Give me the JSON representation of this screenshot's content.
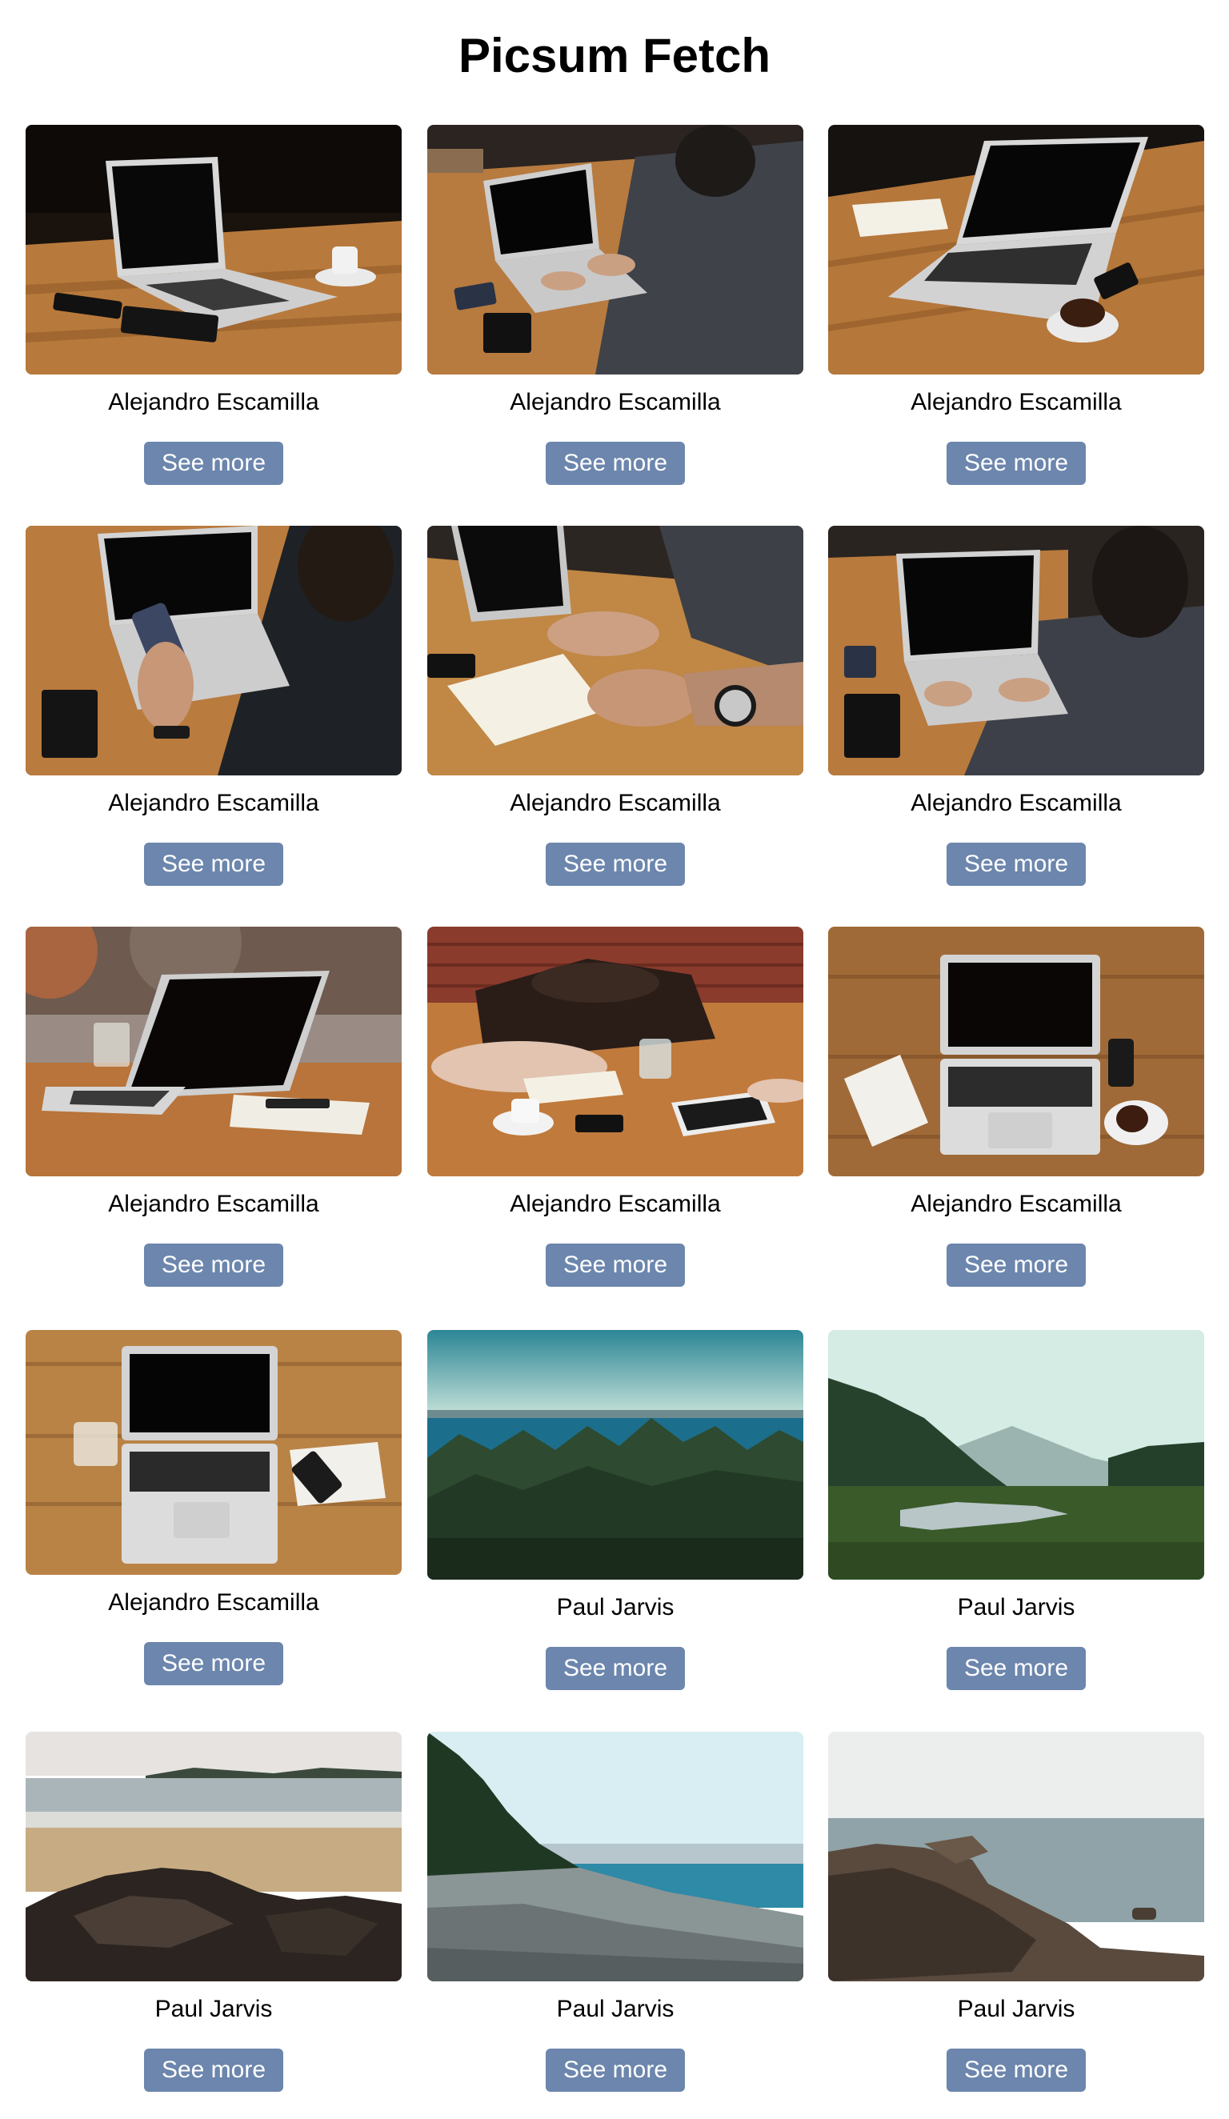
{
  "header": {
    "title": "Picsum Fetch"
  },
  "button_label": "See more",
  "photos": [
    {
      "author": "Alejandro Escamilla",
      "scene": "laptop-on-table"
    },
    {
      "author": "Alejandro Escamilla",
      "scene": "person-typing-laptop"
    },
    {
      "author": "Alejandro Escamilla",
      "scene": "laptop-coffee-table"
    },
    {
      "author": "Alejandro Escamilla",
      "scene": "person-holding-phone"
    },
    {
      "author": "Alejandro Escamilla",
      "scene": "person-writing-notebook"
    },
    {
      "author": "Alejandro Escamilla",
      "scene": "person-typing-laptop"
    },
    {
      "author": "Alejandro Escamilla",
      "scene": "laptop-on-table-bokeh"
    },
    {
      "author": "Alejandro Escamilla",
      "scene": "bag-on-table"
    },
    {
      "author": "Alejandro Escamilla",
      "scene": "laptop-top-view"
    },
    {
      "author": "Alejandro Escamilla",
      "scene": "laptop-top-view-2"
    },
    {
      "author": "Paul Jarvis",
      "scene": "forest-sea"
    },
    {
      "author": "Paul Jarvis",
      "scene": "misty-valley-river"
    },
    {
      "author": "Paul Jarvis",
      "scene": "beach-rocks"
    },
    {
      "author": "Paul Jarvis",
      "scene": "pebble-beach"
    },
    {
      "author": "Paul Jarvis",
      "scene": "rocky-shore"
    }
  ]
}
